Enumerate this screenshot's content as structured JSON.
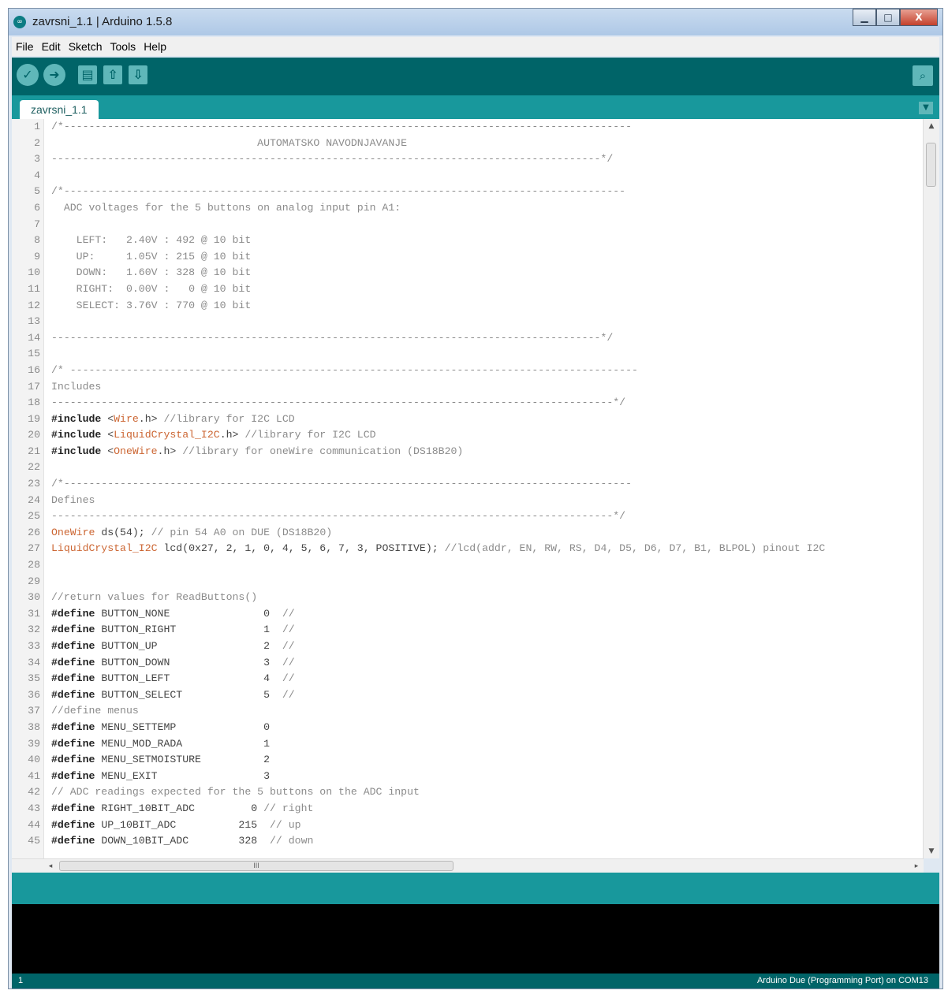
{
  "window": {
    "title": "zavrsni_1.1 | Arduino 1.5.8",
    "app_icon": "arduino-icon",
    "controls": {
      "minimize": "▁",
      "maximize": "□",
      "close": "X"
    }
  },
  "menu": [
    "File",
    "Edit",
    "Sketch",
    "Tools",
    "Help"
  ],
  "toolbar": {
    "buttons": [
      {
        "name": "verify",
        "icon": "check-icon",
        "glyph": "✓"
      },
      {
        "name": "upload",
        "icon": "arrow-right-icon",
        "glyph": "➜"
      },
      {
        "name": "new",
        "icon": "new-file-icon",
        "glyph": "▤"
      },
      {
        "name": "open",
        "icon": "arrow-up-icon",
        "glyph": "⇧"
      },
      {
        "name": "save",
        "icon": "arrow-down-icon",
        "glyph": "⇩"
      }
    ],
    "serial_monitor": {
      "icon": "magnifier-icon",
      "glyph": "⌕"
    }
  },
  "tabs": [
    {
      "label": "zavrsni_1.1"
    }
  ],
  "tab_menu_glyph": "▼",
  "editor": {
    "scroll_up_glyph": "▲",
    "scroll_down_glyph": "▼",
    "scroll_left_glyph": "◂",
    "scroll_right_glyph": "▸",
    "hthumb_grip": "III",
    "lines": [
      {
        "n": "1",
        "parts": [
          [
            "c",
            "/*-------------------------------------------------------------------------------------------"
          ]
        ]
      },
      {
        "n": "2",
        "parts": [
          [
            "c",
            "                                 AUTOMATSKO NAVODNJAVANJE"
          ]
        ]
      },
      {
        "n": "3",
        "parts": [
          [
            "c",
            "----------------------------------------------------------------------------------------*/"
          ]
        ]
      },
      {
        "n": "4",
        "parts": []
      },
      {
        "n": "5",
        "parts": [
          [
            "c",
            "/*------------------------------------------------------------------------------------------"
          ]
        ]
      },
      {
        "n": "6",
        "parts": [
          [
            "c",
            "  ADC voltages for the 5 buttons on analog input pin A1:"
          ]
        ]
      },
      {
        "n": "7",
        "parts": []
      },
      {
        "n": "8",
        "parts": [
          [
            "c",
            "    LEFT:   2.40V : 492 @ 10 bit"
          ]
        ]
      },
      {
        "n": "9",
        "parts": [
          [
            "c",
            "    UP:     1.05V : 215 @ 10 bit"
          ]
        ]
      },
      {
        "n": "10",
        "parts": [
          [
            "c",
            "    DOWN:   1.60V : 328 @ 10 bit"
          ]
        ]
      },
      {
        "n": "11",
        "parts": [
          [
            "c",
            "    RIGHT:  0.00V :   0 @ 10 bit"
          ]
        ]
      },
      {
        "n": "12",
        "parts": [
          [
            "c",
            "    SELECT: 3.76V : 770 @ 10 bit"
          ]
        ]
      },
      {
        "n": "13",
        "parts": []
      },
      {
        "n": "14",
        "parts": [
          [
            "c",
            "----------------------------------------------------------------------------------------*/"
          ]
        ]
      },
      {
        "n": "15",
        "parts": []
      },
      {
        "n": "16",
        "parts": [
          [
            "c",
            "/* -------------------------------------------------------------------------------------------"
          ]
        ]
      },
      {
        "n": "17",
        "parts": [
          [
            "c",
            "Includes"
          ]
        ]
      },
      {
        "n": "18",
        "parts": [
          [
            "c",
            "------------------------------------------------------------------------------------------*/"
          ]
        ]
      },
      {
        "n": "19",
        "parts": [
          [
            "k",
            "#include"
          ],
          [
            "t",
            " <"
          ],
          [
            "l",
            "Wire"
          ],
          [
            "t",
            ".h> "
          ],
          [
            "c",
            "//library for I2C LCD"
          ]
        ]
      },
      {
        "n": "20",
        "parts": [
          [
            "k",
            "#include"
          ],
          [
            "t",
            " <"
          ],
          [
            "l",
            "LiquidCrystal_I2C"
          ],
          [
            "t",
            ".h> "
          ],
          [
            "c",
            "//library for I2C LCD"
          ]
        ]
      },
      {
        "n": "21",
        "parts": [
          [
            "k",
            "#include"
          ],
          [
            "t",
            " <"
          ],
          [
            "l",
            "OneWire"
          ],
          [
            "t",
            ".h> "
          ],
          [
            "c",
            "//library for oneWire communication (DS18B20)"
          ]
        ]
      },
      {
        "n": "22",
        "parts": []
      },
      {
        "n": "23",
        "parts": [
          [
            "c",
            "/*-------------------------------------------------------------------------------------------"
          ]
        ]
      },
      {
        "n": "24",
        "parts": [
          [
            "c",
            "Defines"
          ]
        ]
      },
      {
        "n": "25",
        "parts": [
          [
            "c",
            "------------------------------------------------------------------------------------------*/"
          ]
        ]
      },
      {
        "n": "26",
        "parts": [
          [
            "l",
            "OneWire"
          ],
          [
            "t",
            " ds(54); "
          ],
          [
            "c",
            "// pin 54 A0 on DUE (DS18B20)"
          ]
        ]
      },
      {
        "n": "27",
        "parts": [
          [
            "l",
            "LiquidCrystal_I2C"
          ],
          [
            "t",
            " lcd(0x27, 2, 1, 0, 4, 5, 6, 7, 3, POSITIVE); "
          ],
          [
            "c",
            "//lcd(addr, EN, RW, RS, D4, D5, D6, D7, B1, BLPOL) pinout I2C"
          ]
        ]
      },
      {
        "n": "28",
        "parts": []
      },
      {
        "n": "29",
        "parts": []
      },
      {
        "n": "30",
        "parts": [
          [
            "c",
            "//return values for ReadButtons()"
          ]
        ]
      },
      {
        "n": "31",
        "parts": [
          [
            "k",
            "#define"
          ],
          [
            "t",
            " BUTTON_NONE               0  "
          ],
          [
            "c",
            "//"
          ]
        ]
      },
      {
        "n": "32",
        "parts": [
          [
            "k",
            "#define"
          ],
          [
            "t",
            " BUTTON_RIGHT              1  "
          ],
          [
            "c",
            "//"
          ]
        ]
      },
      {
        "n": "33",
        "parts": [
          [
            "k",
            "#define"
          ],
          [
            "t",
            " BUTTON_UP                 2  "
          ],
          [
            "c",
            "//"
          ]
        ]
      },
      {
        "n": "34",
        "parts": [
          [
            "k",
            "#define"
          ],
          [
            "t",
            " BUTTON_DOWN               3  "
          ],
          [
            "c",
            "//"
          ]
        ]
      },
      {
        "n": "35",
        "parts": [
          [
            "k",
            "#define"
          ],
          [
            "t",
            " BUTTON_LEFT               4  "
          ],
          [
            "c",
            "//"
          ]
        ]
      },
      {
        "n": "36",
        "parts": [
          [
            "k",
            "#define"
          ],
          [
            "t",
            " BUTTON_SELECT             5  "
          ],
          [
            "c",
            "//"
          ]
        ]
      },
      {
        "n": "37",
        "parts": [
          [
            "c",
            "//define menus"
          ]
        ]
      },
      {
        "n": "38",
        "parts": [
          [
            "k",
            "#define"
          ],
          [
            "t",
            " MENU_SETTEMP              0"
          ]
        ]
      },
      {
        "n": "39",
        "parts": [
          [
            "k",
            "#define"
          ],
          [
            "t",
            " MENU_MOD_RADA             1"
          ]
        ]
      },
      {
        "n": "40",
        "parts": [
          [
            "k",
            "#define"
          ],
          [
            "t",
            " MENU_SETMOISTURE          2"
          ]
        ]
      },
      {
        "n": "41",
        "parts": [
          [
            "k",
            "#define"
          ],
          [
            "t",
            " MENU_EXIT                 3"
          ]
        ]
      },
      {
        "n": "42",
        "parts": [
          [
            "c",
            "// ADC readings expected for the 5 buttons on the ADC input"
          ]
        ]
      },
      {
        "n": "43",
        "parts": [
          [
            "k",
            "#define"
          ],
          [
            "t",
            " RIGHT_10BIT_ADC         0 "
          ],
          [
            "c",
            "// right"
          ]
        ]
      },
      {
        "n": "44",
        "parts": [
          [
            "k",
            "#define"
          ],
          [
            "t",
            " UP_10BIT_ADC          215  "
          ],
          [
            "c",
            "// up"
          ]
        ]
      },
      {
        "n": "45",
        "parts": [
          [
            "k",
            "#define"
          ],
          [
            "t",
            " DOWN_10BIT_ADC        328  "
          ],
          [
            "c",
            "// down"
          ]
        ]
      }
    ]
  },
  "status": {
    "line": "1",
    "board": "Arduino Due (Programming Port) on COM13"
  },
  "colors": {
    "toolbar": "#006468",
    "tabbar": "#18989c",
    "library": "#cc6633",
    "comment": "#8b8b8b"
  }
}
